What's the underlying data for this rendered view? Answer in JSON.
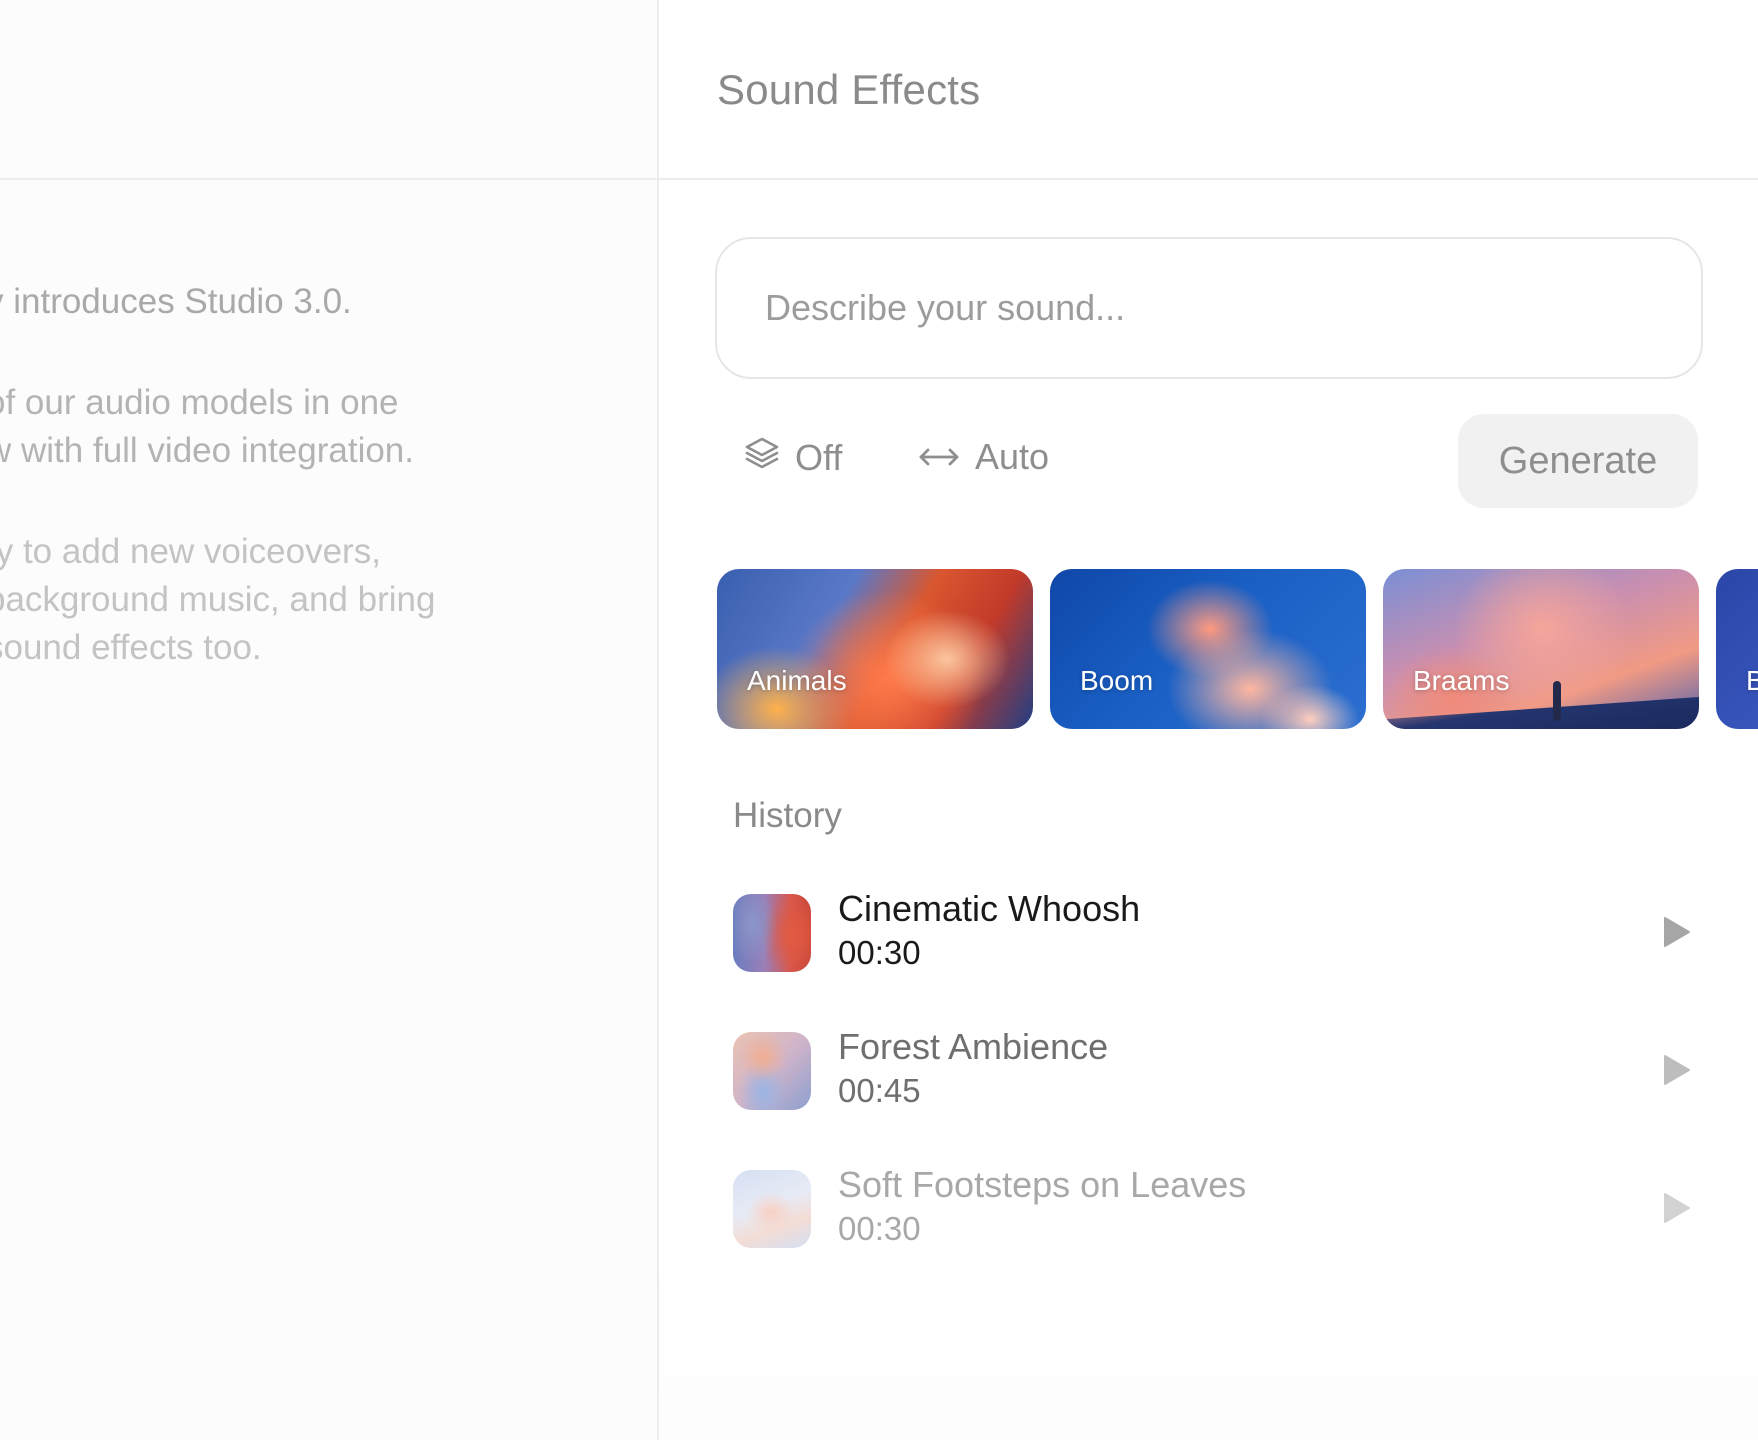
{
  "page": {
    "title": "Sound Effects"
  },
  "left": {
    "paragraphs": [
      [
        "y introduces Studio 3.0."
      ],
      [
        " of our audio models in one",
        "w with full video integration."
      ],
      [
        "ty to add new voiceovers,",
        "background music, and bring",
        "sound effects too."
      ]
    ]
  },
  "search": {
    "placeholder": "Describe your sound..."
  },
  "controls": {
    "layers_label": "Off",
    "duration_label": "Auto",
    "generate_label": "Generate"
  },
  "categories": [
    {
      "label": "Animals"
    },
    {
      "label": "Boom"
    },
    {
      "label": "Braams"
    },
    {
      "label": "B"
    }
  ],
  "history": {
    "title": "History",
    "items": [
      {
        "title": "Cinematic Whoosh",
        "duration": "00:30"
      },
      {
        "title": "Forest Ambience",
        "duration": "00:45"
      },
      {
        "title": "Soft Footsteps on Leaves",
        "duration": "00:30"
      }
    ]
  }
}
